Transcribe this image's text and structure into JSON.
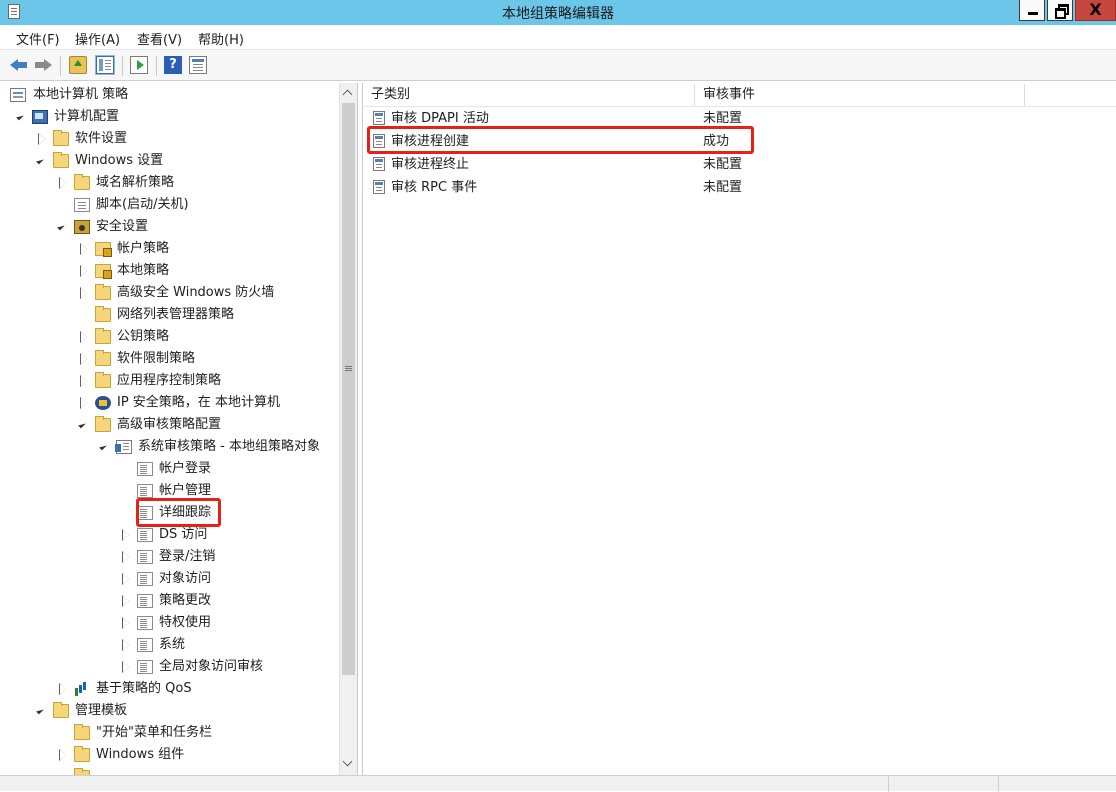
{
  "window": {
    "title": "本地组策略编辑器",
    "close_glyph": "X"
  },
  "menu": [
    "文件(F)",
    "操作(A)",
    "查看(V)",
    "帮助(H)"
  ],
  "toolbar": {
    "help_glyph": "?"
  },
  "tree": {
    "root": "本地计算机 策略",
    "computer_config": "计算机配置",
    "software_settings": "软件设置",
    "windows_settings": "Windows 设置",
    "dns_policy": "域名解析策略",
    "scripts": "脚本(启动/关机)",
    "security_settings": "安全设置",
    "account_policies": "帐户策略",
    "local_policies": "本地策略",
    "firewall": "高级安全 Windows 防火墙",
    "network_list": "网络列表管理器策略",
    "public_key": "公钥策略",
    "software_restriction": "软件限制策略",
    "app_control": "应用程序控制策略",
    "ipsec": "IP 安全策略，在 本地计算机",
    "advanced_audit": "高级审核策略配置",
    "system_audit": "系统审核策略 - 本地组策略对象",
    "account_logon": "帐户登录",
    "account_management": "帐户管理",
    "detailed_tracking": "详细跟踪",
    "ds_access": "DS 访问",
    "logon_logoff": "登录/注销",
    "object_access": "对象访问",
    "policy_change": "策略更改",
    "privilege_use": "特权使用",
    "system": "系统",
    "global_object_access": "全局对象访问审核",
    "qos": "基于策略的 QoS",
    "admin_templates": "管理模板",
    "start_menu": "\"开始\"菜单和任务栏",
    "windows_components": "Windows 组件"
  },
  "list": {
    "columns": [
      "子类别",
      "审核事件"
    ],
    "rows": [
      {
        "name": "审核 DPAPI 活动",
        "value": "未配置"
      },
      {
        "name": "审核进程创建",
        "value": "成功"
      },
      {
        "name": "审核进程终止",
        "value": "未配置"
      },
      {
        "name": "审核 RPC 事件",
        "value": "未配置"
      }
    ]
  },
  "colors": {
    "titlebar": "#6cc6ea",
    "highlight": "#e62117",
    "close": "#c7463d"
  }
}
